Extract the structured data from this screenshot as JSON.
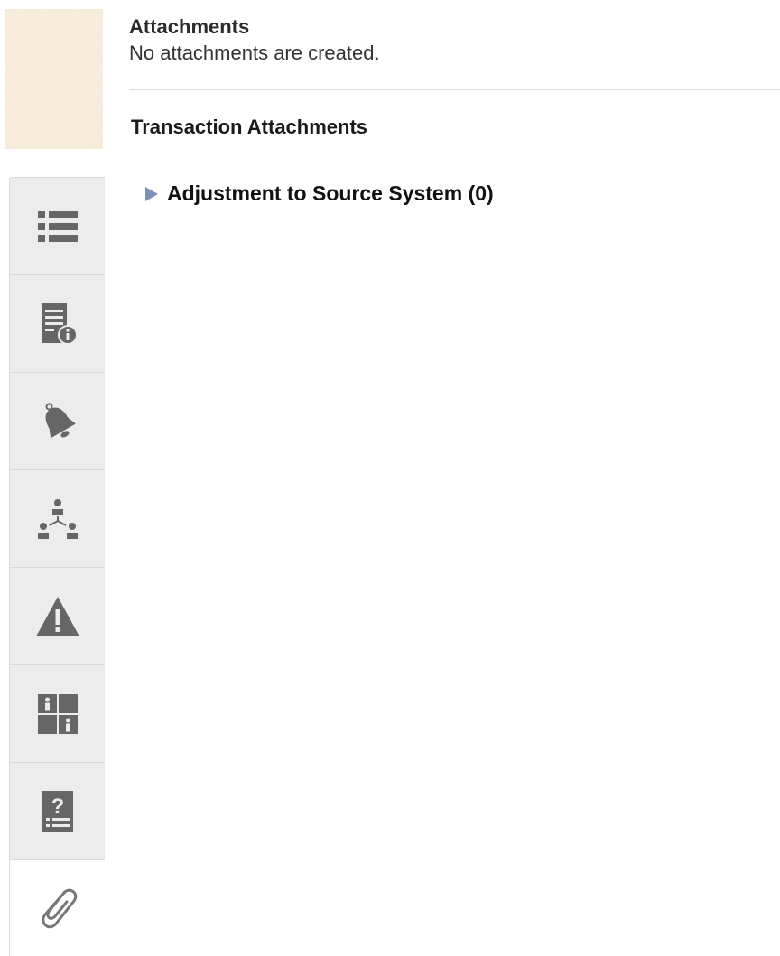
{
  "header": {
    "title": "Attachments",
    "subtitle": "No attachments are created."
  },
  "section": {
    "title": "Transaction Attachments"
  },
  "tree": {
    "items": [
      {
        "label": "Adjustment to Source System (0)",
        "expanded": false,
        "icon": "caret-right-icon"
      }
    ]
  },
  "sidebar": {
    "tabs": [
      {
        "icon": "list-icon",
        "active": false
      },
      {
        "icon": "document-info-icon",
        "active": false
      },
      {
        "icon": "bell-icon",
        "active": false
      },
      {
        "icon": "hierarchy-people-icon",
        "active": false
      },
      {
        "icon": "warning-icon",
        "active": false
      },
      {
        "icon": "user-grid-icon",
        "active": false
      },
      {
        "icon": "help-document-icon",
        "active": false
      },
      {
        "icon": "paperclip-icon",
        "active": true
      }
    ]
  },
  "colors": {
    "icon": "#666666",
    "tab_bg": "#ececec",
    "active_tab_bg": "#ffffff",
    "caret": "#7b8fb8",
    "swatch": "#f6e9d6"
  }
}
